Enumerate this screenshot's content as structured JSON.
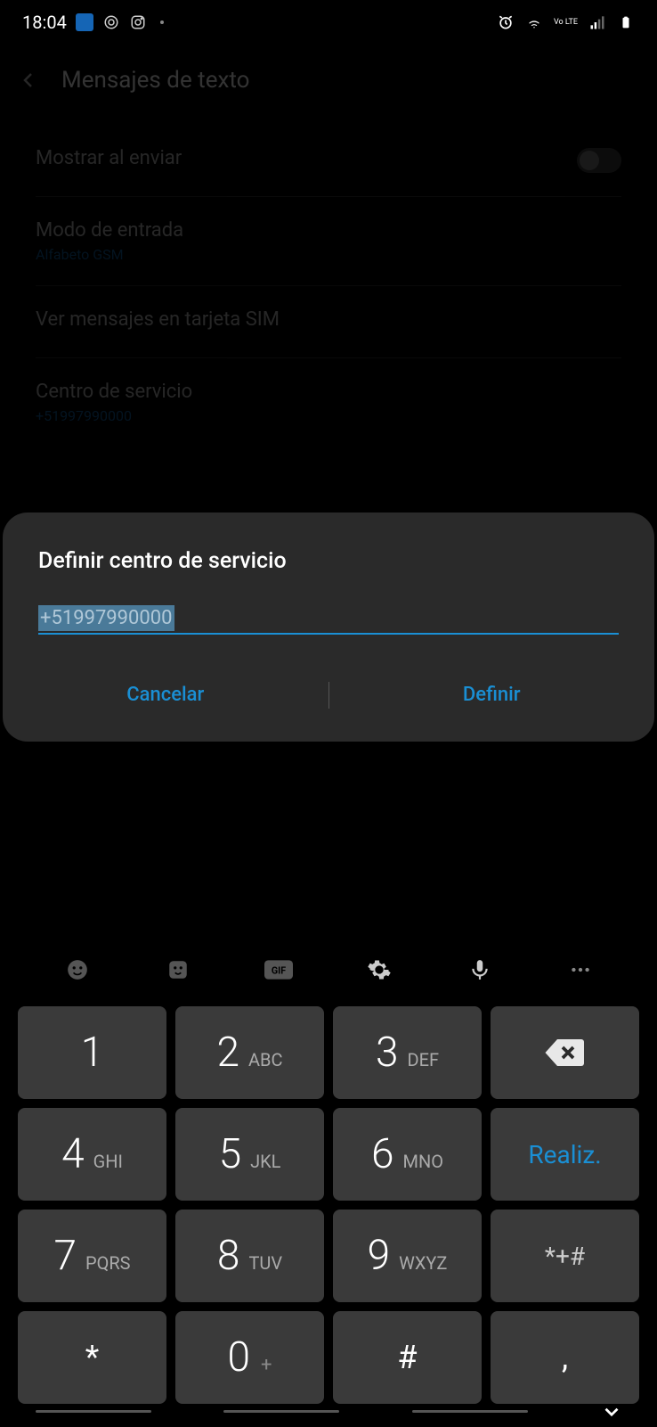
{
  "status": {
    "time": "18:04",
    "volte": "Vo LTE"
  },
  "header": {
    "title": "Mensajes de texto"
  },
  "settings": {
    "show_on_send": {
      "title": "Mostrar al enviar"
    },
    "input_mode": {
      "title": "Modo de entrada",
      "sub": "Alfabeto GSM"
    },
    "sim_messages": {
      "title": "Ver mensajes en tarjeta SIM"
    },
    "service_center": {
      "title": "Centro de servicio",
      "sub": "+51997990000"
    }
  },
  "dialog": {
    "title": "Definir centro de servicio",
    "value": "+51997990000",
    "cancel": "Cancelar",
    "ok": "Definir"
  },
  "keypad": {
    "rows": [
      [
        {
          "num": "1",
          "letters": ""
        },
        {
          "num": "2",
          "letters": "ABC"
        },
        {
          "num": "3",
          "letters": "DEF"
        },
        {
          "action": "backspace"
        }
      ],
      [
        {
          "num": "4",
          "letters": "GHI"
        },
        {
          "num": "5",
          "letters": "JKL"
        },
        {
          "num": "6",
          "letters": "MNO"
        },
        {
          "action": "done",
          "label": "Realiz."
        }
      ],
      [
        {
          "num": "7",
          "letters": "PQRS"
        },
        {
          "num": "8",
          "letters": "TUV"
        },
        {
          "num": "9",
          "letters": "WXYZ"
        },
        {
          "symbol": "*+#"
        }
      ],
      [
        {
          "symbol_large": "*"
        },
        {
          "num": "0",
          "plus": "+"
        },
        {
          "symbol_large": "#"
        },
        {
          "symbol_large": ","
        }
      ]
    ]
  }
}
